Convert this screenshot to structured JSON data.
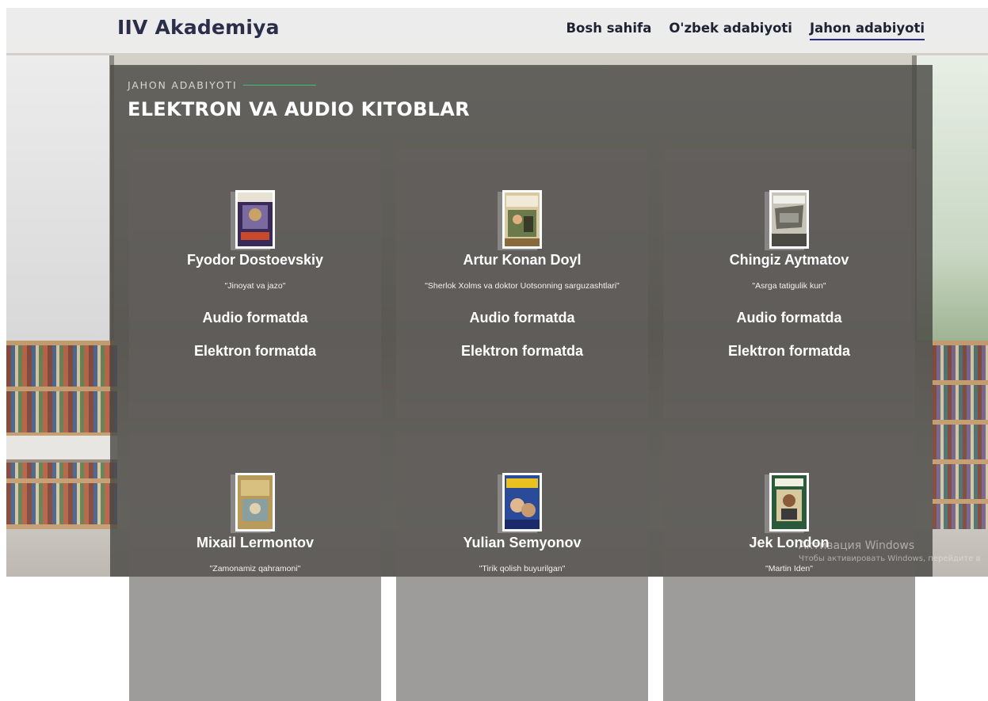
{
  "navbar": {
    "brand": "IIV Akademiya",
    "links": [
      {
        "label": "Bosh sahifa",
        "active": false
      },
      {
        "label": "O'zbek adabiyoti",
        "active": false
      },
      {
        "label": "Jahon adabiyoti",
        "active": true
      }
    ]
  },
  "section": {
    "tag": "JAHON ADABIYOTI",
    "title": "ELEKTRON VA AUDIO KITOBLAR"
  },
  "cards": [
    {
      "author": "Fyodor Dostoevskiy",
      "book": "\"Jinoyat va jazo\"",
      "audio_label": "Audio formatda",
      "electronic_label": "Elektron formatda"
    },
    {
      "author": "Artur Konan Doyl",
      "book": "\"Sherlok Xolms va doktor Uotsonning sarguzashtlari\"",
      "audio_label": "Audio formatda",
      "electronic_label": "Elektron formatda"
    },
    {
      "author": "Chingiz Aytmatov",
      "book": "\"Asrga tatigulik kun\"",
      "audio_label": "Audio formatda",
      "electronic_label": "Elektron formatda"
    },
    {
      "author": "Mixail Lermontov",
      "book": "\"Zamonamiz qahramoni\""
    },
    {
      "author": "Yulian Semyonov",
      "book": "\"Tirik qolish buyurilgan\""
    },
    {
      "author": "Jek London",
      "book": "\"Martin Iden\""
    }
  ],
  "watermark": {
    "line1": "Активация Windows",
    "line2": "Чтобы активировать Windows, перейдите в"
  },
  "colors": {
    "brand": "#2b2e4a",
    "nav_underline": "#2b2a8c",
    "accent_line": "#3cbf7a",
    "panel": "#4b4946"
  }
}
